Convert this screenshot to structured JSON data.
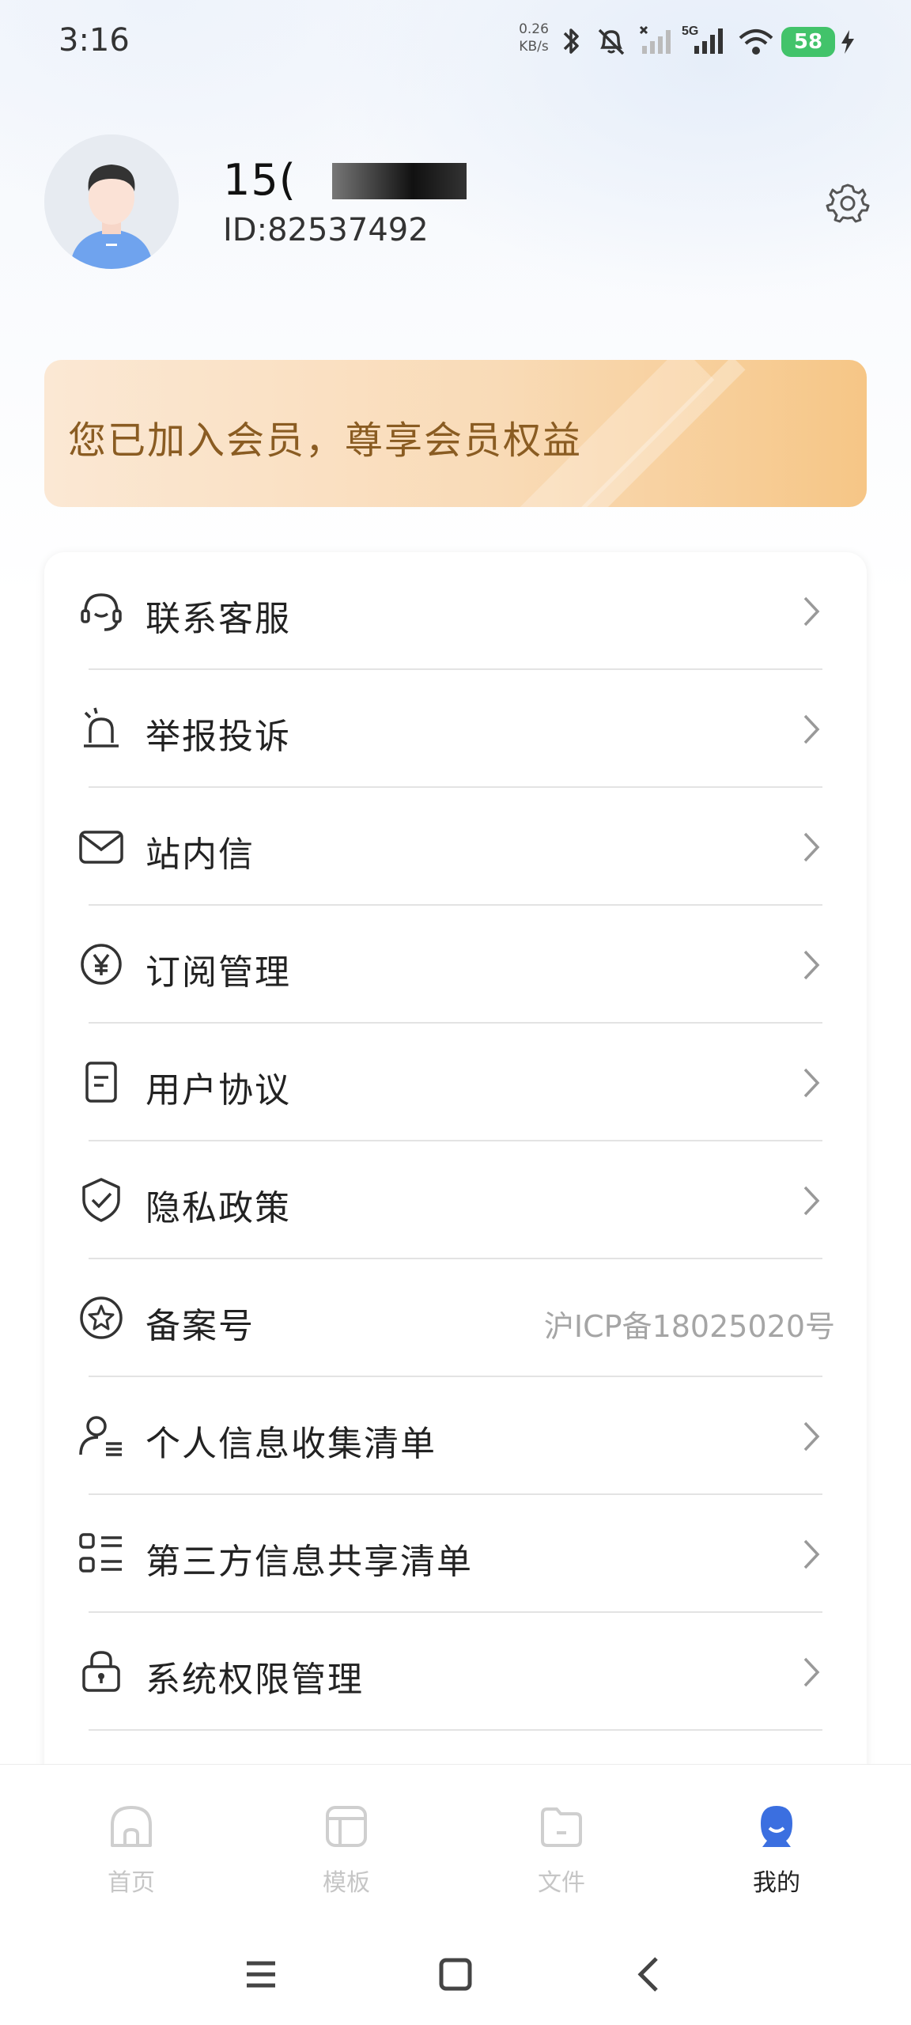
{
  "status_bar": {
    "time": "3:16",
    "net_speed_value": "0.26",
    "net_speed_unit": "KB/s",
    "network_type": "5G",
    "battery": "58"
  },
  "profile": {
    "username_visible": "15(",
    "user_id": "ID:82537492"
  },
  "member_banner": {
    "text": "您已加入会员，尊享会员权益"
  },
  "menu": [
    {
      "label": "联系客服",
      "icon": "headset-icon"
    },
    {
      "label": "举报投诉",
      "icon": "alarm-icon"
    },
    {
      "label": "站内信",
      "icon": "mail-icon"
    },
    {
      "label": "订阅管理",
      "icon": "yen-icon"
    },
    {
      "label": "用户协议",
      "icon": "document-icon"
    },
    {
      "label": "隐私政策",
      "icon": "shield-check-icon"
    },
    {
      "label": "备案号",
      "icon": "star-badge-icon",
      "value": "沪ICP备18025020号"
    },
    {
      "label": "个人信息收集清单",
      "icon": "user-list-icon"
    },
    {
      "label": "第三方信息共享清单",
      "icon": "checklist-icon"
    },
    {
      "label": "系统权限管理",
      "icon": "lock-icon"
    }
  ],
  "tab_bar": {
    "tabs": [
      {
        "label": "首页",
        "icon": "home-icon"
      },
      {
        "label": "模板",
        "icon": "template-icon"
      },
      {
        "label": "文件",
        "icon": "folder-icon"
      },
      {
        "label": "我的",
        "icon": "profile-icon"
      }
    ],
    "active_index": 3
  },
  "colors": {
    "accent": "#3b6fe0",
    "banner_text": "#8a5c22",
    "battery": "#42c36a",
    "inactive_tab": "#c6c6c6"
  }
}
